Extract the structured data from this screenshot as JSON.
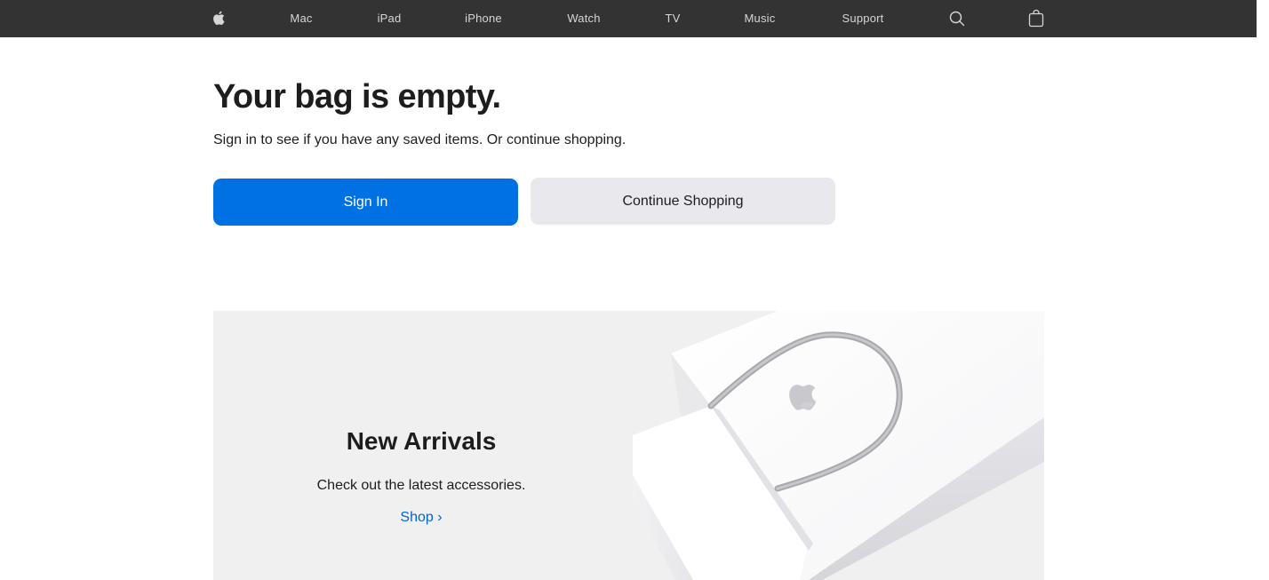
{
  "nav": {
    "logo_icon": "apple-logo-icon",
    "items": [
      {
        "label": "Mac"
      },
      {
        "label": "iPad"
      },
      {
        "label": "iPhone"
      },
      {
        "label": "Watch"
      },
      {
        "label": "TV"
      },
      {
        "label": "Music"
      },
      {
        "label": "Support"
      }
    ],
    "search_icon": "search-icon",
    "bag_icon": "shopping-bag-icon"
  },
  "bag": {
    "title": "Your bag is empty.",
    "message": "Sign in to see if you have any saved items. Or continue shopping.",
    "sign_in_label": "Sign In",
    "continue_label": "Continue Shopping"
  },
  "promo": {
    "title": "New Arrivals",
    "copy": "Check out the latest accessories.",
    "link_label": "Shop ›",
    "image_icon": "shopping-bag-photo"
  },
  "colors": {
    "nav_bg": "#333333",
    "primary": "#0071e3",
    "secondary_button": "#e8e8ed",
    "link": "#0066cc",
    "promo_bg": "#f0f0f0"
  }
}
